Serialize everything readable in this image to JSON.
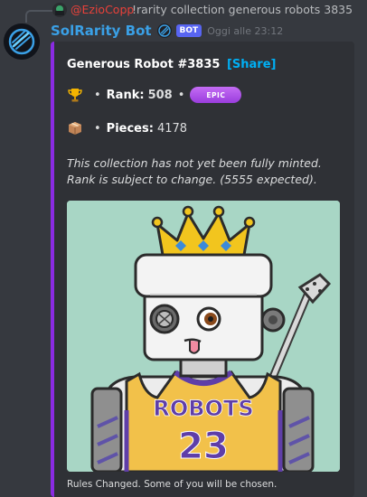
{
  "reply": {
    "username": "@EzioCopp",
    "command": "!rarity collection generous robots 3835"
  },
  "message": {
    "author": "SolRarity Bot",
    "bot_tag": "BOT",
    "timestamp": "Oggi alle 23:12"
  },
  "embed": {
    "accent_color": "#8a2be2",
    "title": "Generous Robot #3835",
    "share_label": "[Share]",
    "rank_label": "Rank:",
    "rank_value": "508",
    "rarity_badge": "EPIC",
    "pieces_label": "Pieces:",
    "pieces_value": "4178",
    "note": "This collection has not yet been fully minted. Rank is subject to change. (5555 expected).",
    "image": {
      "jersey_text": "ROBOTS",
      "jersey_number": "23"
    },
    "footer": "Rules Changed. Some of you will be chosen."
  },
  "icons": {
    "rank": "trophy-icon",
    "pieces": "package-icon",
    "verified": "verified-icon"
  }
}
